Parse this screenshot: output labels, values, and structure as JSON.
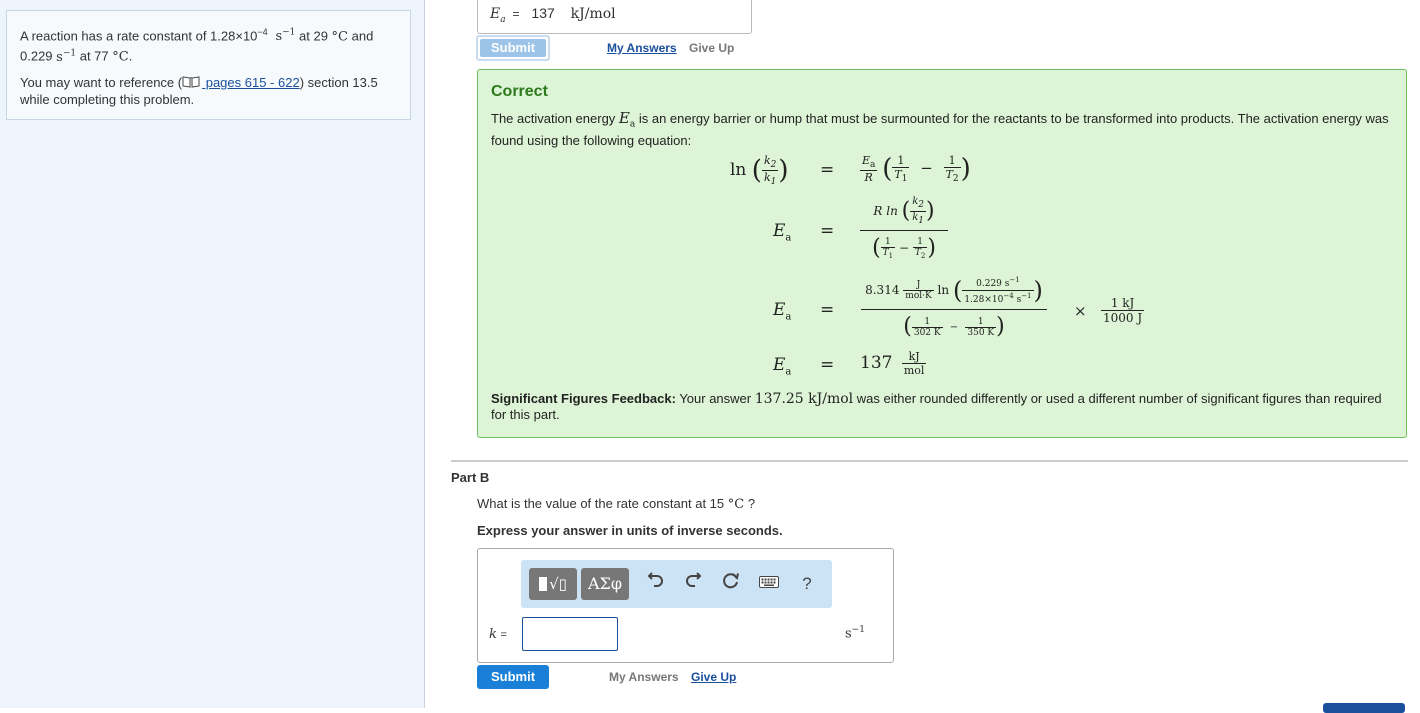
{
  "intro": {
    "line1_a": "A reaction has a rate constant of 1.28×10",
    "line1_exp": "−4",
    "line1_unit": "s",
    "line1_unit_exp": "−1",
    "line1_b": " at 29 ",
    "line1_deg": "°C",
    "line1_c": " and",
    "line2_a": "0.229 ",
    "line2_unit": "s",
    "line2_unit_exp": "−1",
    "line2_b": " at 77 ",
    "line2_deg": "°C",
    "line2_c": ".",
    "ref_a": "You may want to reference (",
    "ref_link": " pages 615 - 622",
    "ref_b": ") section 13.5",
    "ref_c": "while completing this problem."
  },
  "part_a": {
    "answer_label": "E",
    "answer_sub": "a",
    "answer_eq": "=",
    "answer_value": "137",
    "answer_unit": "kJ/mol",
    "submit": "Submit",
    "my_answers": "My Answers",
    "give_up": "Give Up"
  },
  "feedback": {
    "title": "Correct",
    "text_a": "The activation energy ",
    "text_Ea": "E",
    "text_Ea_sub": "a",
    "text_b": " is an energy barrier or hump that must be surmounted for the reactants to be transformed into products. The activation energy was found using the following equation:",
    "eq": {
      "ln": "ln",
      "k2": "k",
      "k2_sub": "2",
      "k1": "k",
      "k1_sub": "1",
      "eqsign": "=",
      "Ea": "E",
      "Ea_sub": "a",
      "R": "R",
      "one": "1",
      "T1": "T",
      "T1_sub": "1",
      "T2": "T",
      "T2_sub": "2",
      "minus": "−",
      "R_ln": "R ln",
      "val_8314": "8.314",
      "unit_J": "J",
      "unit_molK": "mol·K",
      "num_0229": "0.229 s",
      "exp_neg1": "−1",
      "den_128": "1.28×10",
      "exp_neg4": "−4",
      "den_s": " s",
      "T1_val": "302 K",
      "T2_val": "350 K",
      "times": "×",
      "conv_num": "1 kJ",
      "conv_den": "1000 J",
      "result": "137",
      "result_unit_num": "kJ",
      "result_unit_den": "mol"
    },
    "sigfig_label": "Significant Figures Feedback:",
    "sigfig_a": " Your answer ",
    "sigfig_value": "137.25 kJ/mol",
    "sigfig_b": " was either rounded differently or used a different number of significant figures than required for this part."
  },
  "part_b": {
    "title": "Part B",
    "question_a": "What is the value of the rate constant at 15 ",
    "question_deg": "°C",
    "question_b": " ?",
    "express": "Express your answer in units of inverse seconds.",
    "toolbar": {
      "templates": "√▯",
      "greek": "ΑΣφ",
      "help": "?"
    },
    "k_label": "k",
    "k_eq": "=",
    "unit": "s",
    "unit_exp": "−1",
    "submit": "Submit",
    "my_answers": "My Answers",
    "give_up": "Give Up"
  },
  "colors": {
    "correct_bg": "#ddf5d6",
    "correct_border": "#6cbf5c",
    "submit_blue": "#1a7fd6",
    "link_blue": "#1a4f9c"
  }
}
